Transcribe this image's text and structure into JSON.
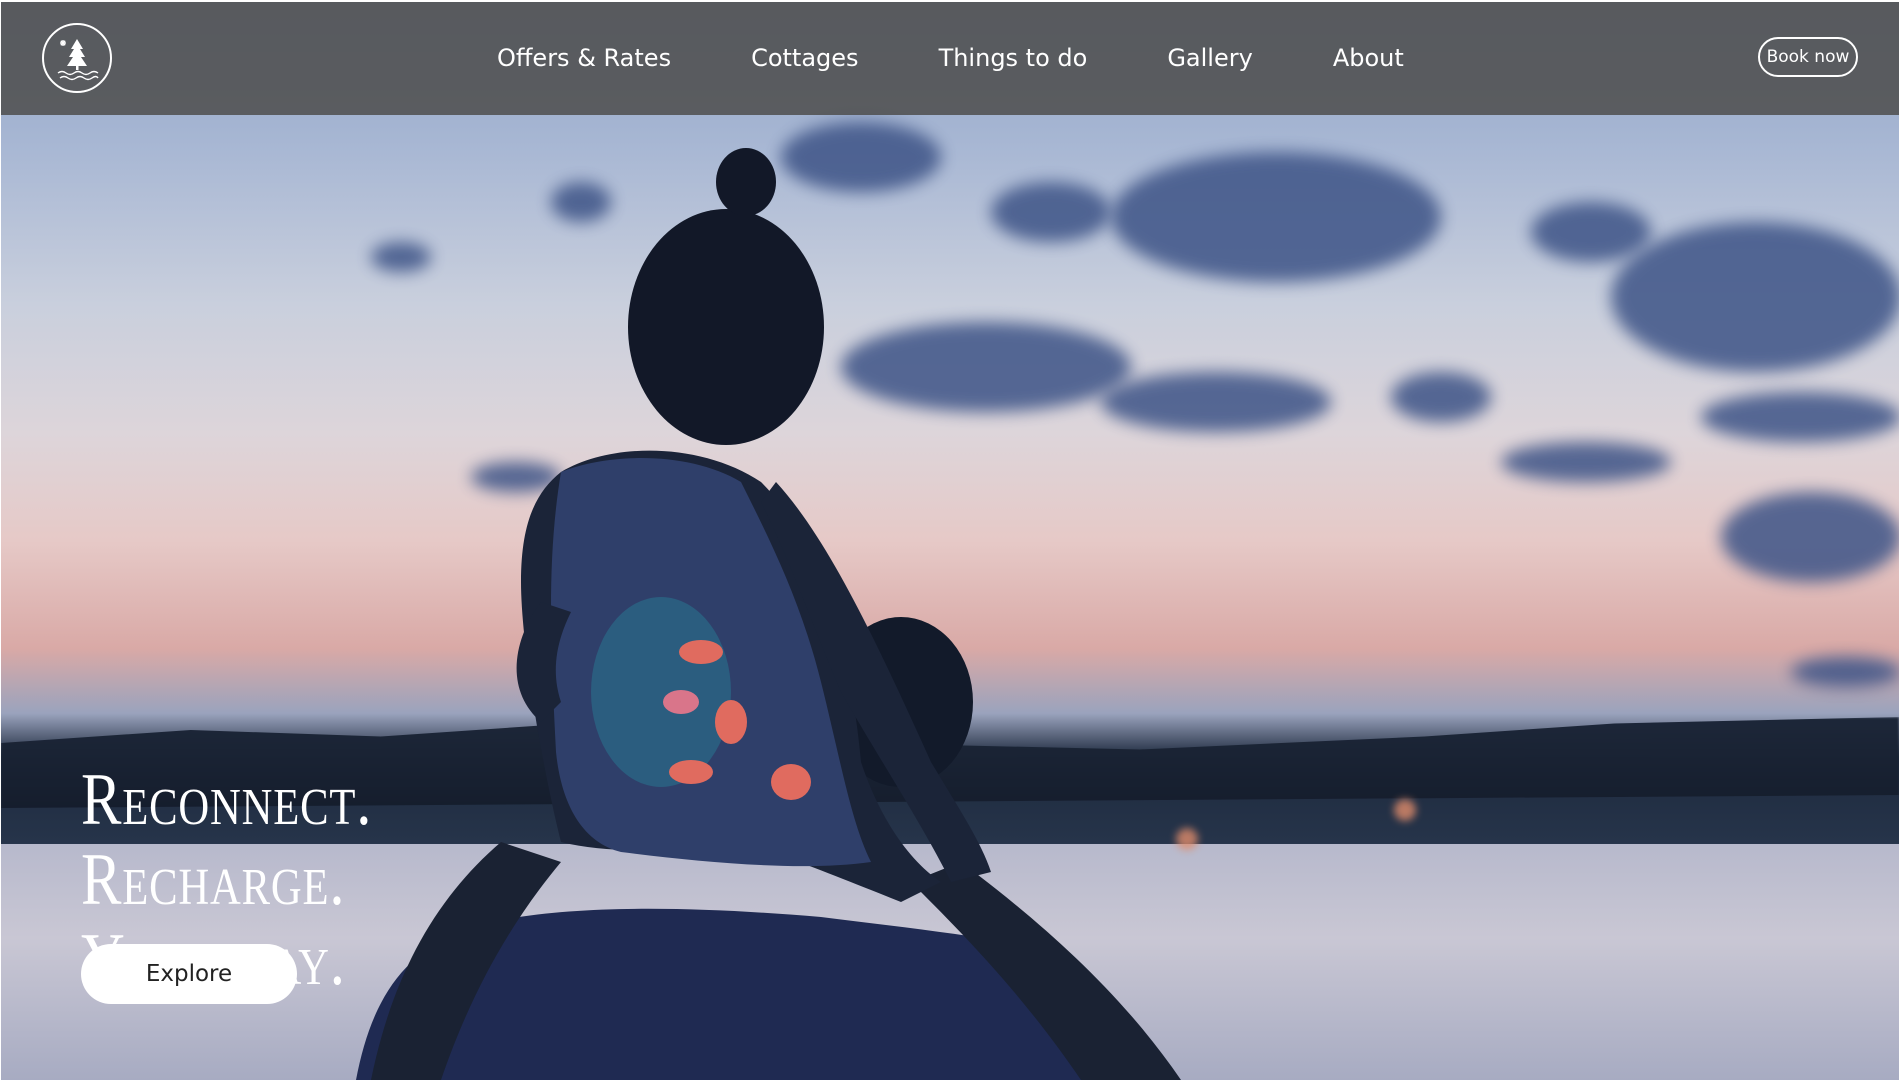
{
  "nav": {
    "logo_icon": "tree-sun-waves-logo-icon",
    "links": [
      "Offers & Rates",
      "Cottages",
      "Things to do",
      "Gallery",
      "About"
    ],
    "book_label": "Book now"
  },
  "hero": {
    "headline_line1": "Reconnect. Recharge.",
    "headline_line2": "Your way.",
    "cta_label": "Explore"
  },
  "colors": {
    "nav_bg": "#505050",
    "text": "#ffffff",
    "button_bg": "#ffffff"
  }
}
